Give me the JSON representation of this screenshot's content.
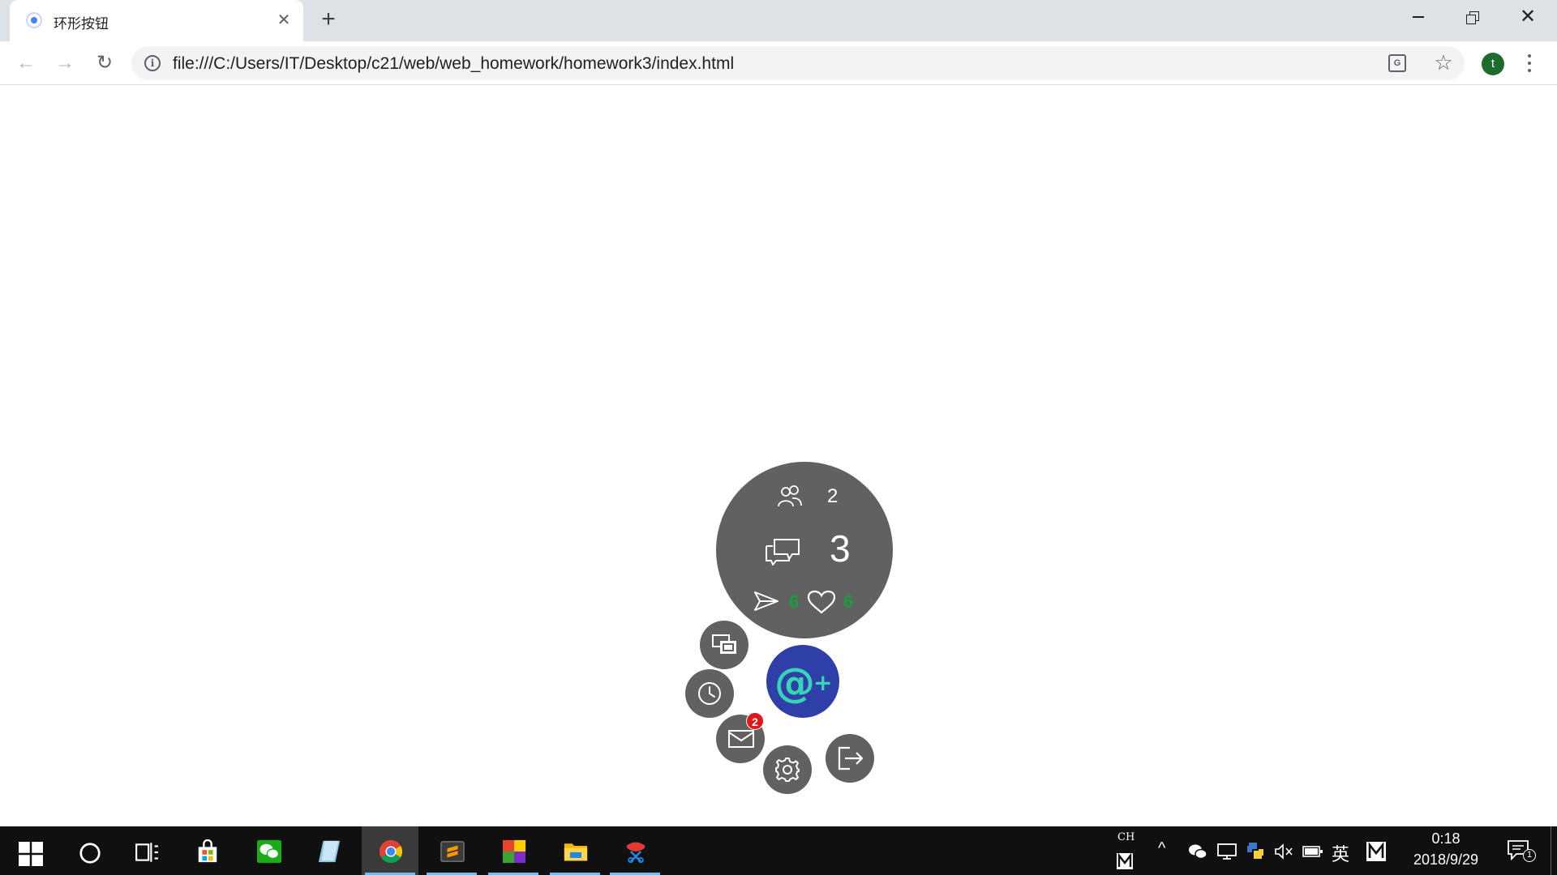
{
  "browser": {
    "tab_title": "环形按钮",
    "close_glyph": "✕",
    "newtab_glyph": "+",
    "url": "file:///C:/Users/IT/Desktop/c21/web/web_homework/homework3/index.html",
    "profile_initial": "t",
    "window_close_glyph": "✕"
  },
  "nav": {
    "back_glyph": "←",
    "forward_glyph": "→",
    "reload_glyph": "↻"
  },
  "widget": {
    "followers_count": "2",
    "messages_count": "3",
    "shares_count": "6",
    "likes_count": "6",
    "mail_badge": "2",
    "main_button_glyph": "@+",
    "accent_color": "#2f3fa8",
    "bubble_color": "#616161",
    "highlight_color": "#1a9e3e"
  },
  "taskbar": {
    "ime_short": "CH",
    "ime_label": "英",
    "clock_time": "0:18",
    "clock_date": "2018/9/29",
    "notification_count": "1",
    "apps": [
      "start",
      "search",
      "task-view",
      "store",
      "wechat",
      "notepad",
      "chrome",
      "sublime",
      "office",
      "explorer",
      "snipping"
    ]
  }
}
